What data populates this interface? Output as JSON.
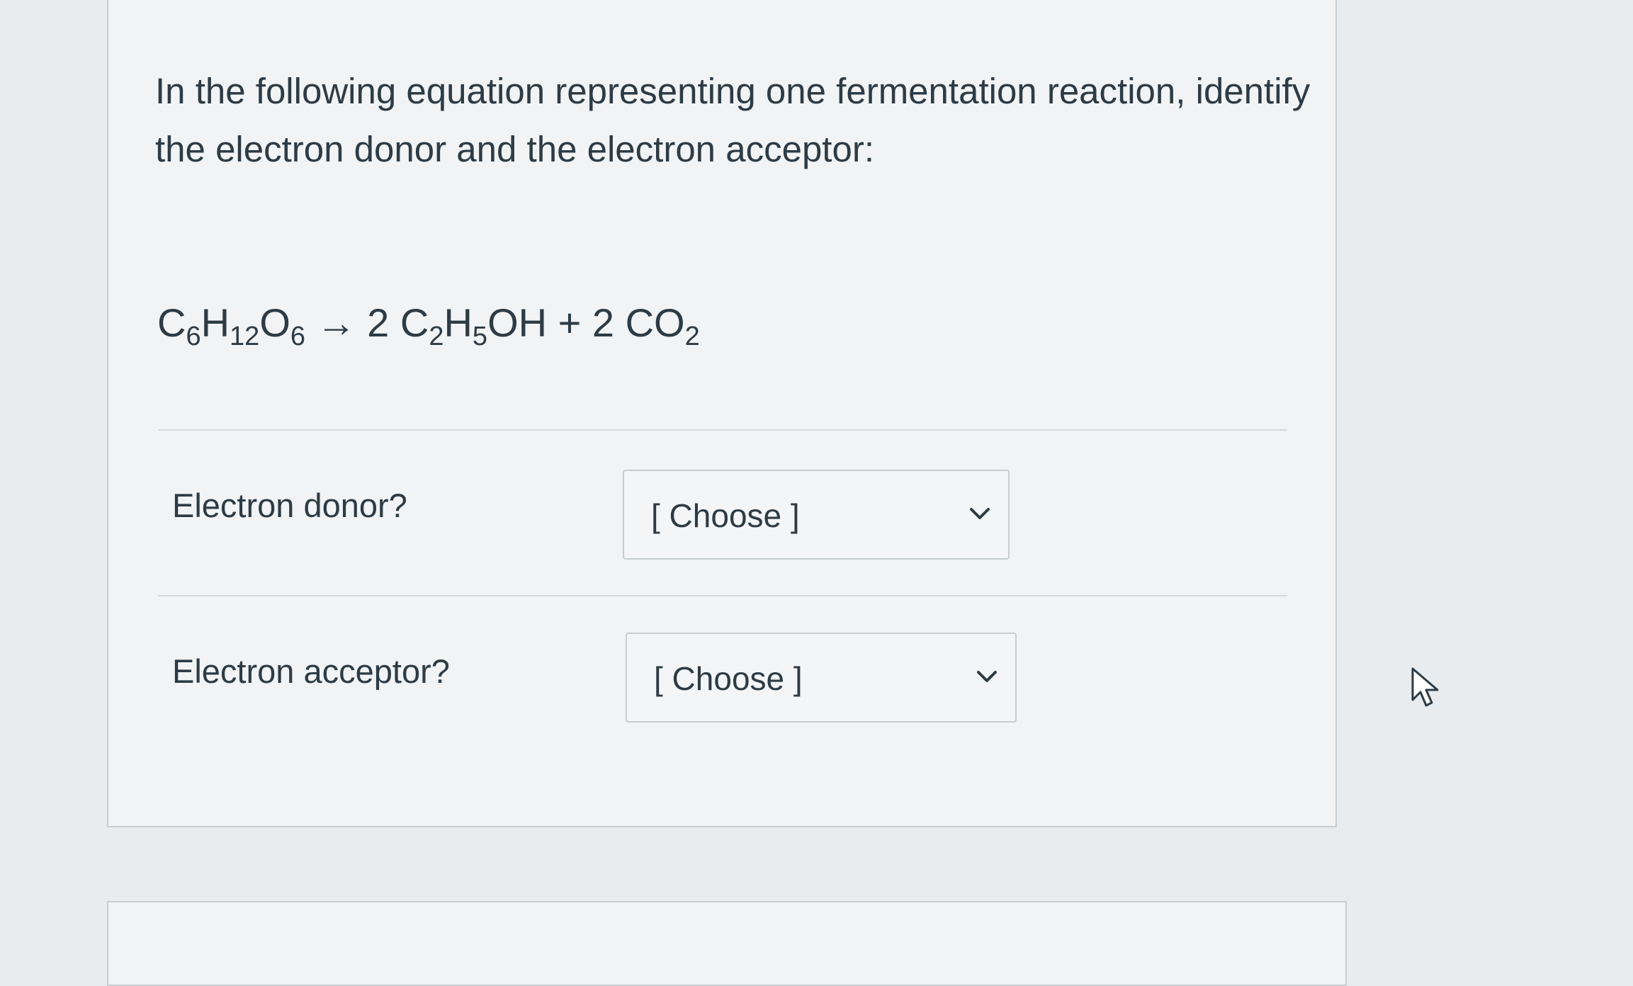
{
  "question": {
    "prompt": "In the following equation representing one fermentation reaction, identify the electron donor and the electron acceptor:",
    "equation": {
      "reactant": {
        "c": "C",
        "c_sub": "6",
        "h": "H",
        "h_sub": "12",
        "o": "O",
        "o_sub": "6"
      },
      "arrow": "→",
      "product1_coef": "2",
      "product1": {
        "c": "C",
        "c_sub": "2",
        "h": "H",
        "h_sub": "5",
        "rest": "OH"
      },
      "plus": "+",
      "product2_coef": "2",
      "product2": {
        "c": "CO",
        "o_sub": "2"
      }
    }
  },
  "rows": [
    {
      "label": "Electron donor?",
      "select_value": "[ Choose ]",
      "icon": "chevron-down-icon"
    },
    {
      "label": "Electron acceptor?",
      "select_value": "[ Choose ]",
      "icon": "chevron-down-icon"
    }
  ],
  "colors": {
    "text": "#2d3b45",
    "border": "#c7cdd1",
    "background": "#e9ecee",
    "card": "#f1f3f4"
  }
}
